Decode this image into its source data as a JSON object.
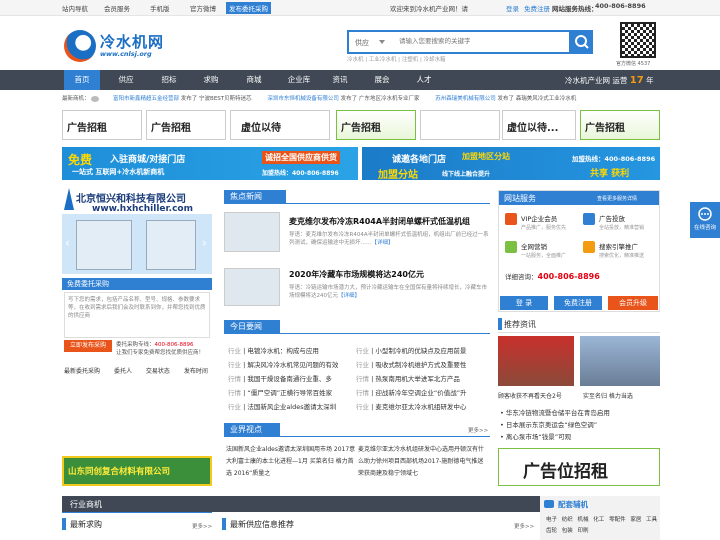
{
  "topbar": {
    "site_nav": "站内导航",
    "member_service": "会员服务",
    "mobile": "手机版",
    "weibo": "官方微博",
    "post_free": "发布委托采购",
    "welcome": "欢迎来到冷水机产业网！请",
    "login": "登录",
    "register": "免费注册",
    "hotline_label": "网站服务热线：",
    "hotline": "400-806-8896"
  },
  "header": {
    "logo_text": "冷水机网",
    "logo_url": "www.cnlsj.org",
    "search_category": "供应",
    "search_placeholder": "请输入您要搜索的关键字",
    "hot_words": "冷水机 | 工业冷水机 | 注塑机 | 冷却水箱",
    "qr_label": "官方微信 4537"
  },
  "nav": {
    "items": [
      "首页",
      "供应",
      "招标",
      "求购",
      "商城",
      "企业库",
      "资讯",
      "展会",
      "人才"
    ],
    "slogan": "冷水机产业网 运营",
    "years": "17",
    "year_unit": "年"
  },
  "ticker": {
    "label": "最新商机：",
    "item1_co": "富阳市新鑫精超五金经营部",
    "item1_action": "发布了",
    "item1_text": "宁波BEST贝斯特迷芯",
    "item2_co": "深圳市东恒机械设备有限公司",
    "item2_action": "发布了",
    "item2_text": "广东地区冷水机专业厂家",
    "item3_co": "苏州森瑞美机械有限公司",
    "item3_action": "发布了",
    "item3_text": "森瑞美风冷式工业冷水机"
  },
  "ads": {
    "recruit": "广告招租",
    "vacant": "虚位以待",
    "vacant_short": "虚位以待..."
  },
  "banner1": {
    "free": "免费",
    "line1": "入驻商城/对接门店",
    "line2": "一站式 互联网+冷水机新商机",
    "badge": "诚招全国供应商供货",
    "hotline": "加盟热线：400-806-8896"
  },
  "banner2": {
    "line1": "诚邀各地门店",
    "badge": "加盟地区分站",
    "line2": "加盟分站",
    "line3": "线下线上融合提升",
    "hotline": "加盟热线：400-806-8896",
    "brand": "共享 获利"
  },
  "left": {
    "company_name": "北京恒兴和科技有限公司",
    "company_url": "www.hxhchiller.com",
    "free_title": "免费委托采购",
    "free_text": "写下您的需求，包括产品名称、型号、规格、参数要求等，在收到需求后我们会及时联系到你，并帮您找到优质的供应商",
    "post_btn": "立即发布采购",
    "hotline_label": "委托采购专线：",
    "hotline": "400-806-8896",
    "hotline_note": "让我们专家免费帮您找优质供应商！",
    "links": [
      "最新委托采购",
      "委托人",
      "交易状态",
      "发布时间"
    ],
    "bottom_ad": "山东同创复合材料有限公司"
  },
  "center": {
    "focus_title": "焦点新闻",
    "headline1": "麦克维尔发布冷冻R404A半封闭单螺杆式低温机组",
    "desc1": "导语：麦克维尔发布冷冻R404A半封闭单螺杆式低温机组，机组出厂前已经过一系列测试，确保运输途中无损坏……",
    "detail": "【详细】",
    "headline2": "2020年冷藏车市场规模将达240亿元",
    "desc2": "导语：冷链运输市场潜力大，预计冷藏运输车在全国保有量将持续增长，冷藏车市场规模将达240亿元",
    "today_title": "今日要闻",
    "news": [
      {
        "cat": "行业",
        "text": "电镀冷水机：构成与应用"
      },
      {
        "cat": "行业",
        "text": "解决风冷冷水机常见问题的有效"
      },
      {
        "cat": "行情",
        "text": "我国干燥设备南通行业重、多"
      },
      {
        "cat": "行情",
        "text": "“僵尸空调”正横行导常百姓家"
      },
      {
        "cat": "行业",
        "text": "法国新风企业aldes邀请太深圳"
      }
    ],
    "news_r": [
      {
        "cat": "行业",
        "text": "小型制冷机的优缺点及应用前景"
      },
      {
        "cat": "行业",
        "text": "吸收式制冷机维护方式及重要性"
      },
      {
        "cat": "行情",
        "text": "热泵南用机大举进军北方产品"
      },
      {
        "cat": "行情",
        "text": "迎战新冷年空调企业“价值战”升"
      },
      {
        "cat": "行业",
        "text": "麦克维尔亚太冷水机组研发中心"
      }
    ],
    "view_title": "业界视点",
    "more": "更多>>",
    "view_left": "法国新风企业aldes邀请太深圳国用市场 2017意大利富士康的本土化进程—1月 买菜名归 格力首选 2016“质量之",
    "view_right": "麦克维尔亚太冷水机组研发中心选用丹顿汉有什么助力徐州项目西部机场2017-施耐德电气推迷荣获商建及稳宁领域七"
  },
  "right": {
    "svc_title": "网站服务",
    "svc_more": "查看更多服务详情",
    "svc_items": [
      {
        "title": "VIP企业会员",
        "sub": "产品推广，服务优先"
      },
      {
        "title": "广告投放",
        "sub": "全站投放，精准营销"
      },
      {
        "title": "全网营销",
        "sub": "一站服务，全面推广"
      },
      {
        "title": "搜索引擎推广",
        "sub": "搜索优化，精准推送"
      }
    ],
    "consult_label": "详细咨询：",
    "consult_hotline": "400-806-8896",
    "btn_login": "登 录",
    "btn_register": "免费注册",
    "btn_member": "会员升级",
    "rec_title": "推荐资讯",
    "rec_cap1": "顾客收获不再看天仓2号",
    "rec_cap2": "实至名归 格力当选",
    "rec_list": [
      "华东冷链物流暨仓储平台在青岛启用",
      "日本展示东京奥运会“绿色空调”",
      "离心泵市场“钱景”可观"
    ],
    "big_ad": "广告位招租"
  },
  "float": {
    "label": "在线咨询"
  },
  "bottom": {
    "industry": "行业商机",
    "buy_title": "最新求购",
    "supply_title": "最新供应信息推荐",
    "more": "更多>>",
    "parts_title": "配套辅机",
    "parts": [
      "电子",
      "纺织",
      "机械",
      "化工",
      "零配件",
      "家居",
      "工具",
      "齿轮",
      "包装",
      "印刷"
    ]
  },
  "colors": {
    "primary": "#2f7fd3",
    "nav_bg": "#3f4854",
    "hot": "#e60012",
    "orange": "#e8541a",
    "green": "#7cc043"
  }
}
